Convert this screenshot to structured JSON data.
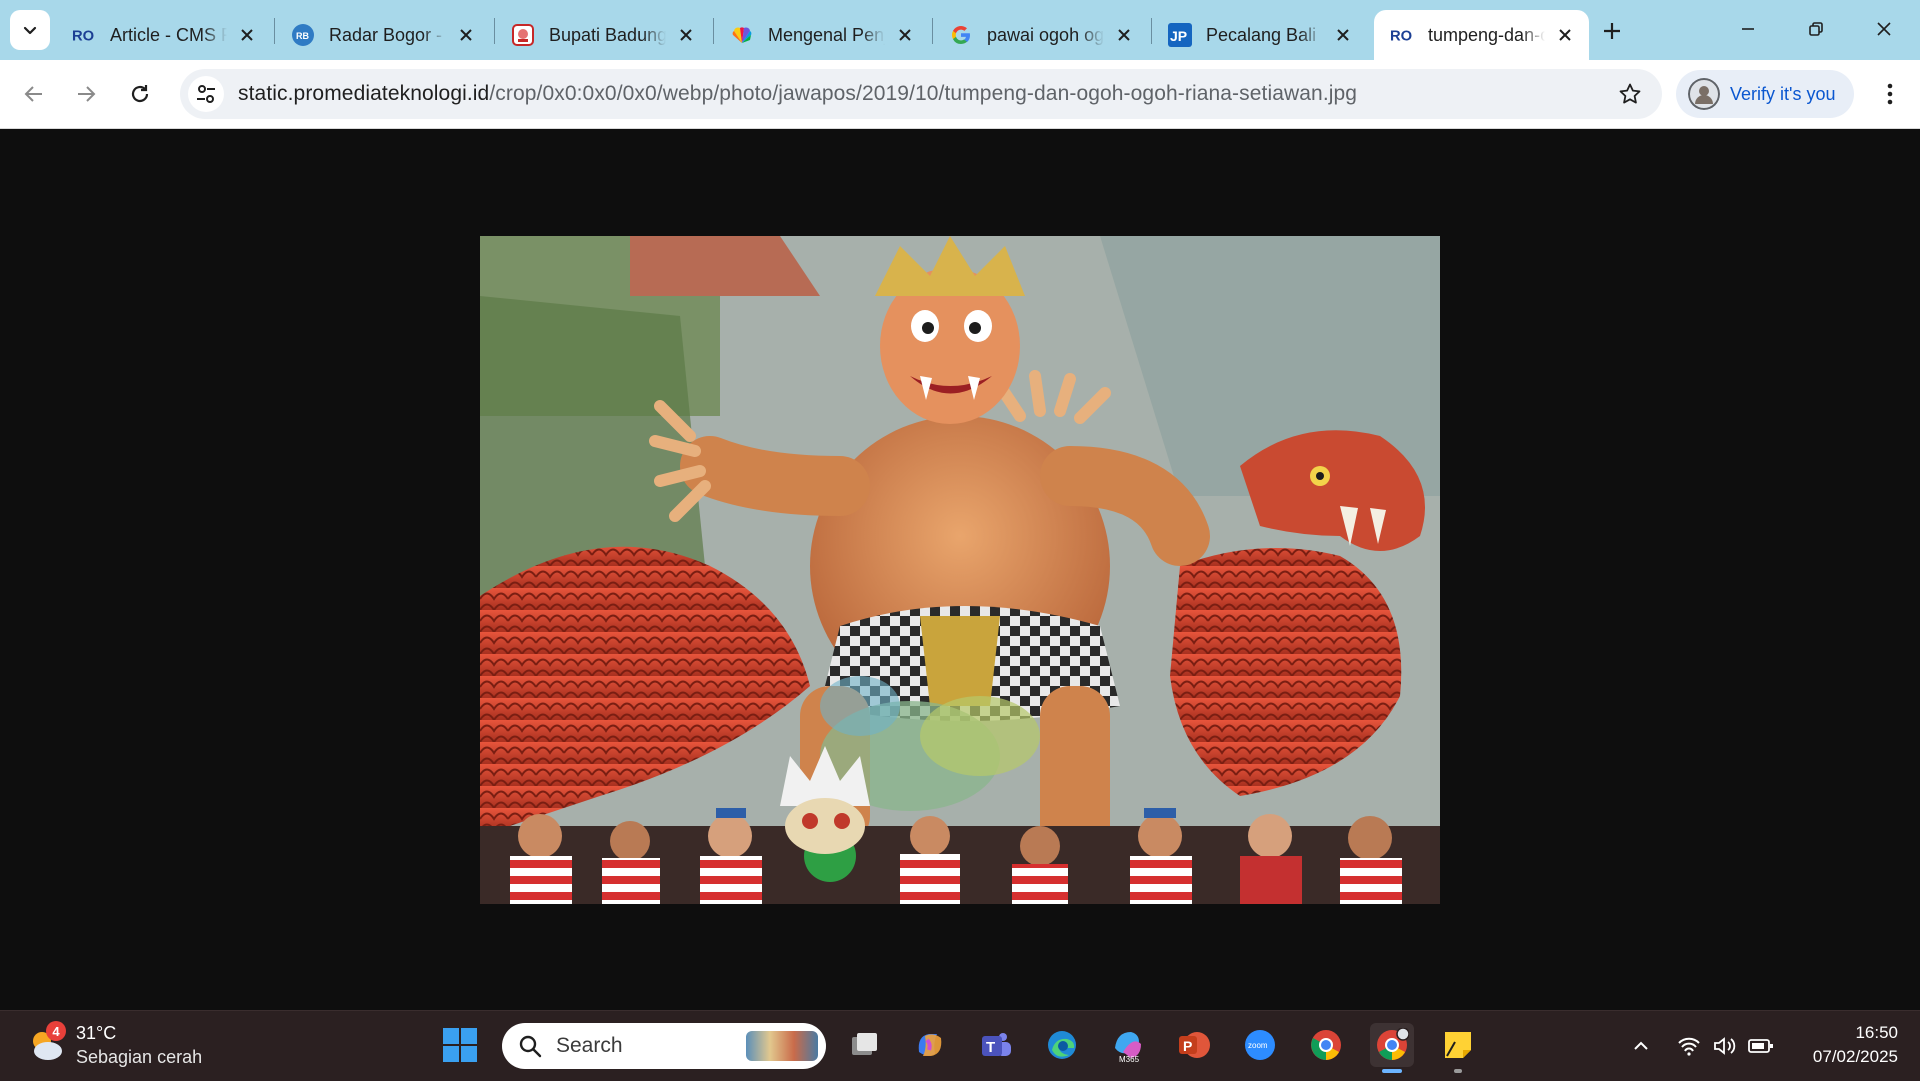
{
  "browser": {
    "tabs": [
      {
        "title": "Article - CMS RO",
        "favicon": "ro-logo-icon",
        "active": false
      },
      {
        "title": "Radar Bogor - Berita",
        "favicon": "rb-logo-icon",
        "active": false
      },
      {
        "title": "Bupati Badung",
        "favicon": "mascot-logo-icon",
        "active": false
      },
      {
        "title": "Mengenal Penjor",
        "favicon": "nbc-peacock-icon",
        "active": false
      },
      {
        "title": "pawai ogoh ogoh",
        "favicon": "google-g-icon",
        "active": false
      },
      {
        "title": "Pecalang Bali",
        "favicon": "jp-logo-icon",
        "active": false
      },
      {
        "title": "tumpeng-dan-ogoh-ogoh",
        "favicon": "ro-logo-icon",
        "active": true
      }
    ],
    "url_host": "static.promediateknologi.id",
    "url_path": "/crop/0x0:0x0/0x0/webp/photo/jawapos/2019/10/tumpeng-dan-ogoh-ogoh-riana-setiawan.jpg",
    "verify_label": "Verify it's you",
    "accent": "#a8d8ea"
  },
  "taskbar": {
    "weather": {
      "temp": "31°C",
      "desc": "Sebagian cerah",
      "badge": "4"
    },
    "search_label": "Search",
    "pinned": [
      "task-view-icon",
      "copilot-icon",
      "teams-icon",
      "edge-icon",
      "m365-icon",
      "powerpoint-icon",
      "zoom-icon",
      "chrome-icon",
      "chrome-profile-icon",
      "sticky-notes-icon"
    ],
    "clock": {
      "time": "16:50",
      "date": "07/02/2025"
    }
  }
}
